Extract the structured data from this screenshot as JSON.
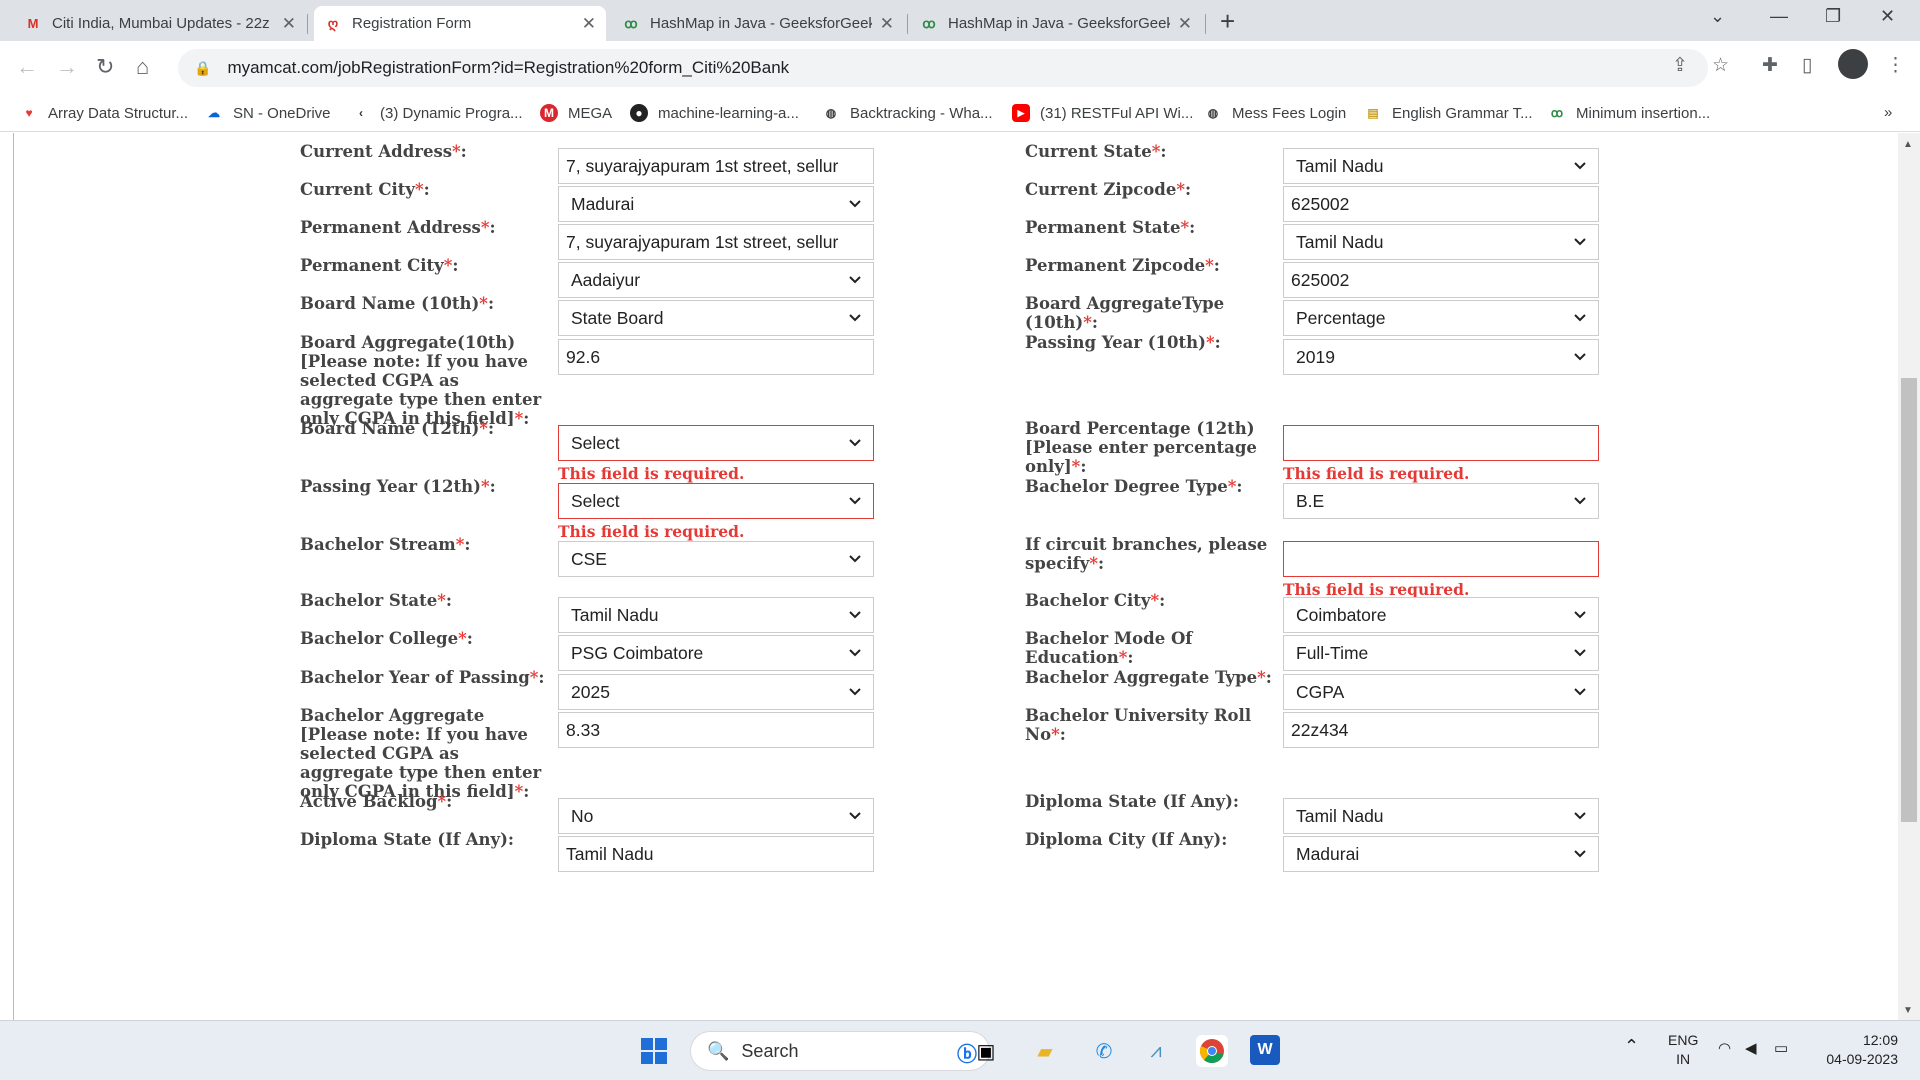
{
  "browser": {
    "tabs": [
      {
        "label": "Citi India, Mumbai Updates - 22z",
        "icon": "gmail-icon"
      },
      {
        "label": "Registration Form",
        "icon": "amcat-icon"
      },
      {
        "label": "HashMap in Java - GeeksforGeek",
        "icon": "gfg-icon"
      },
      {
        "label": "HashMap in Java - GeeksforGeek",
        "icon": "gfg-icon"
      }
    ],
    "url": "myamcat.com/jobRegistrationForm?id=Registration%20form_Citi%20Bank",
    "bookmarks": [
      "Array Data Structur...",
      "SN - OneDrive",
      "(3) Dynamic Progra...",
      "MEGA",
      "machine-learning-a...",
      "Backtracking - Wha...",
      "(31) RESTFul API Wi...",
      "Mess Fees Login",
      "English Grammar T...",
      "Minimum insertion..."
    ],
    "more_bookmarks": "»"
  },
  "form": {
    "required_mark": "*",
    "error_text": "This field is required.",
    "left": [
      {
        "label": "Current Address",
        "colon": ":",
        "value": "7, suyarajyapuram 1st street, sellur",
        "kind": "input"
      },
      {
        "label": "Current City",
        "colon": ":",
        "value": "Madurai",
        "kind": "select"
      },
      {
        "label": "Permanent Address",
        "colon": ":",
        "value": "7, suyarajyapuram 1st street, sellur",
        "kind": "input"
      },
      {
        "label": "Permanent City",
        "colon": ":",
        "value": "Aadaiyur",
        "kind": "select"
      },
      {
        "label": "Board Name (10th)",
        "colon": ":",
        "value": "State Board",
        "kind": "select"
      },
      {
        "label": "Board Aggregate(10th) [Please note: If you have selected CGPA as aggregate type then enter only CGPA in this field]",
        "colon": ":",
        "value": "92.6",
        "kind": "input"
      },
      {
        "label": "Board Name (12th)",
        "colon": ":",
        "value": "Select",
        "kind": "select",
        "error": true
      },
      {
        "label": "Passing Year (12th)",
        "colon": ":",
        "value": "Select",
        "kind": "select",
        "error": true
      },
      {
        "label": "Bachelor Stream",
        "colon": ":",
        "value": "CSE",
        "kind": "select"
      },
      {
        "label": "Bachelor State",
        "colon": ":",
        "value": "Tamil Nadu",
        "kind": "select"
      },
      {
        "label": "Bachelor College",
        "colon": ":",
        "value": "PSG Coimbatore",
        "kind": "select"
      },
      {
        "label": "Bachelor Year of Passing",
        "colon": ":",
        "value": "2025",
        "kind": "select"
      },
      {
        "label": "Bachelor Aggregate [Please note: If you have selected CGPA as aggregate type then enter only CGPA in this field]",
        "colon": ":",
        "value": "8.33",
        "kind": "input"
      },
      {
        "label": "Active Backlog",
        "colon": ":",
        "value": "No",
        "kind": "select"
      },
      {
        "label": "Diploma State (If Any):",
        "colon": "",
        "value": "Tamil Nadu",
        "kind": "input",
        "optional": true
      }
    ],
    "right": [
      {
        "label": "Current State",
        "colon": ":",
        "value": "Tamil Nadu",
        "kind": "select"
      },
      {
        "label": "Current Zipcode",
        "colon": ":",
        "value": "625002",
        "kind": "input"
      },
      {
        "label": "Permanent State",
        "colon": ":",
        "value": "Tamil Nadu",
        "kind": "select"
      },
      {
        "label": "Permanent Zipcode",
        "colon": ":",
        "value": "625002",
        "kind": "input"
      },
      {
        "label": "Board AggregateType (10th)",
        "colon": ":",
        "value": "Percentage",
        "kind": "select"
      },
      {
        "label": "Passing Year (10th)",
        "colon": ":",
        "value": "2019",
        "kind": "select"
      },
      {
        "label": "Board Percentage (12th) [Please enter percentage only]",
        "colon": ":",
        "value": "",
        "kind": "input",
        "error": true
      },
      {
        "label": "Bachelor Degree Type",
        "colon": ":",
        "value": "B.E",
        "kind": "select"
      },
      {
        "label": "If circuit branches, please specify",
        "colon": ":",
        "value": "",
        "kind": "input",
        "error": true
      },
      {
        "label": "Bachelor City",
        "colon": ":",
        "value": "Coimbatore",
        "kind": "select"
      },
      {
        "label": "Bachelor Mode Of Education",
        "colon": ":",
        "value": "Full-Time",
        "kind": "select"
      },
      {
        "label": "Bachelor Aggregate Type",
        "colon": ":",
        "value": "CGPA",
        "kind": "select"
      },
      {
        "label": "Bachelor University Roll No",
        "colon": ":",
        "value": "22z434",
        "kind": "input"
      },
      {
        "label": "Diploma State (If Any):",
        "colon": "",
        "value": "Tamil Nadu",
        "kind": "select",
        "optional": true
      },
      {
        "label": "Diploma City (If Any):",
        "colon": "",
        "value": "Madurai",
        "kind": "select",
        "optional": true
      }
    ]
  },
  "taskbar": {
    "search_placeholder": "Search",
    "lang_top": "ENG",
    "lang_bottom": "IN",
    "time": "12:09",
    "date": "04-09-2023"
  }
}
